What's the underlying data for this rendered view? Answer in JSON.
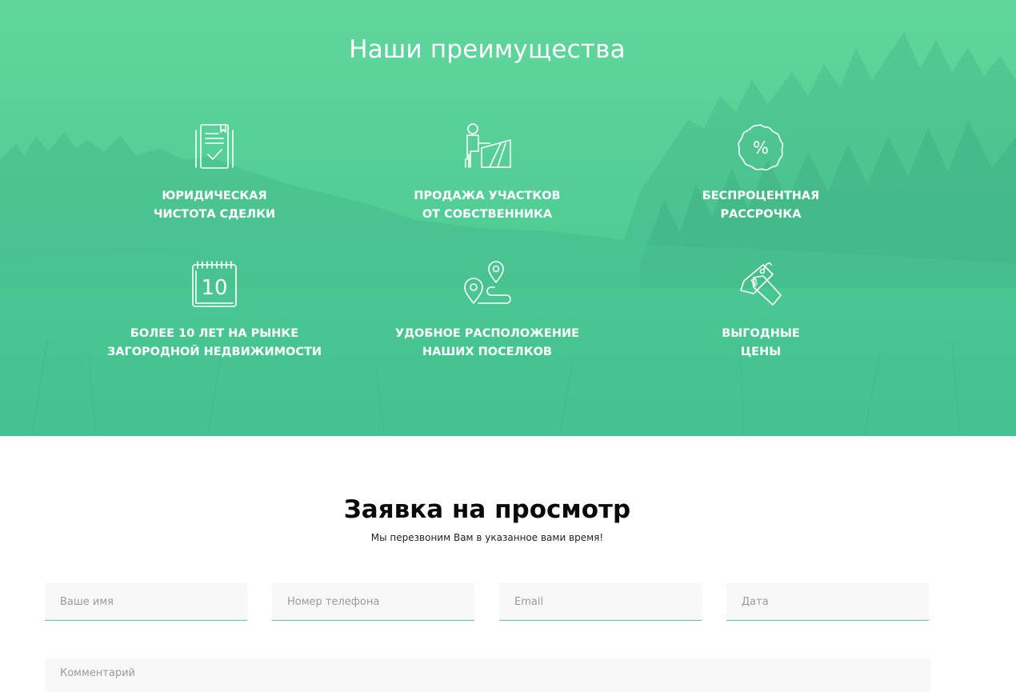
{
  "advantages": {
    "title": "Наши преимущества",
    "items": [
      {
        "icon": "document-check-icon",
        "label": "Юридическая\nчистота сделки"
      },
      {
        "icon": "owner-land-icon",
        "label": "Продажа участков\nот собственника"
      },
      {
        "icon": "percent-badge-icon",
        "label": "Беспроцентная\nрассрочка"
      },
      {
        "icon": "calendar-10-icon",
        "calendar_day": "10",
        "label": "Более 10 лет на рынке\nзагородной недвижимости"
      },
      {
        "icon": "location-route-icon",
        "label": "Удобное расположение\nнаших поселков"
      },
      {
        "icon": "price-tag-icon",
        "label": "Выгодные\nцены"
      }
    ]
  },
  "request_form": {
    "title": "Заявка на просмотр",
    "subtitle": "Мы перезвоним Вам в указанное вами время!",
    "fields": {
      "name": {
        "placeholder": "Ваше имя",
        "value": ""
      },
      "phone": {
        "placeholder": "Номер телефона",
        "value": ""
      },
      "email": {
        "placeholder": "Email",
        "value": ""
      },
      "date": {
        "placeholder": "Дата",
        "value": ""
      },
      "comment": {
        "placeholder": "Комментарий",
        "value": ""
      }
    }
  },
  "colors": {
    "accent_green": "#4fcb92",
    "field_underline": "#5cc98f",
    "field_background": "#f8f8f8"
  }
}
